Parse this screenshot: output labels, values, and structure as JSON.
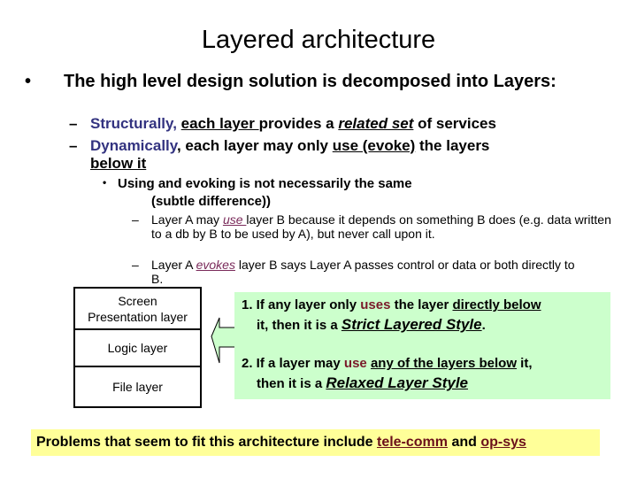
{
  "title": "Layered architecture",
  "bullet1": {
    "marker": "•",
    "text": "The high level design solution is decomposed into Layers:"
  },
  "sub_bullets": [
    {
      "marker": "–",
      "lead": "Structurally,",
      "part1": "each layer ",
      "part2": "provides a ",
      "part3": "related set",
      "part4": " of services"
    },
    {
      "marker": "–",
      "lead": "Dynamically",
      "part1": ", each layer may only ",
      "part2": "use (evoke)",
      "part3": " the layers",
      "part4": "below it"
    }
  ],
  "bullet3": {
    "marker": "•",
    "line1": "Using and evoking is not necessarily the same",
    "line2": "(subtle difference))"
  },
  "notes": [
    {
      "marker": "–",
      "pre": "Layer A may ",
      "emph": "use ",
      "post": "layer B because it depends on something B does (e.g. data written to a db by B to be used by A), but never call upon it."
    },
    {
      "marker": "–",
      "pre": "Layer A ",
      "emph": "evokes",
      "post": " layer B says Layer A passes control or data or both directly to B."
    }
  ],
  "layers": [
    {
      "line1": "Screen",
      "line2": "Presentation layer"
    },
    {
      "line1": "Logic layer"
    },
    {
      "line1": "File layer"
    }
  ],
  "rules": [
    {
      "num": "1.",
      "pre": " If any layer only ",
      "key": "uses",
      "mid": " the layer ",
      "under": "directly below",
      "pre2": "it, then it is a ",
      "style": "Strict Layered Style",
      "end": "."
    },
    {
      "num": "2.",
      "pre": " If a layer may ",
      "key": "use",
      "mid": " ",
      "under": "any of the layers below",
      "after": " it,",
      "pre2": "then it is a ",
      "style": "Relaxed Layer Style",
      "end": ""
    }
  ],
  "footer": {
    "pre": "Problems that seem to fit this architecture include ",
    "link1": "tele-comm",
    "mid": " and ",
    "link2": "op-sys"
  },
  "colors": {
    "blue_text": "#333380",
    "purple_text": "#7a2a5a",
    "maroon_text": "#7a1a2a",
    "green_box": "#ccffcc",
    "yellow_box": "#ffff99"
  }
}
